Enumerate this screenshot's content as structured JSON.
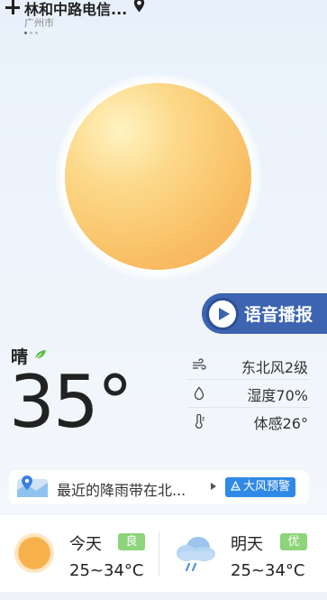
{
  "header": {
    "location": "林和中路电信...",
    "city": "广州市",
    "page_dots": 3,
    "active_dot": 0
  },
  "voice_button": {
    "label": "语音播报"
  },
  "current": {
    "condition": "晴",
    "temperature": "35°",
    "metrics": [
      {
        "icon": "wind-icon",
        "value": "东北风2级"
      },
      {
        "icon": "humidity-icon",
        "value": "湿度70%"
      },
      {
        "icon": "thermometer-icon",
        "value": "体感26°"
      }
    ]
  },
  "alert": {
    "text": "最近的降雨带在北...",
    "badge": "大风预警",
    "badge_color": "#2f89e6"
  },
  "forecast": {
    "today": {
      "label": "今天",
      "aqi": "良",
      "temp": "25~34°C",
      "icon": "sun-icon"
    },
    "tomorrow": {
      "label": "明天",
      "aqi": "优",
      "temp": "25~34°C",
      "icon": "rain-cloud-icon"
    }
  },
  "colors": {
    "voice_button": "#3d64b1",
    "aqi_badge": "#8ed47a"
  }
}
